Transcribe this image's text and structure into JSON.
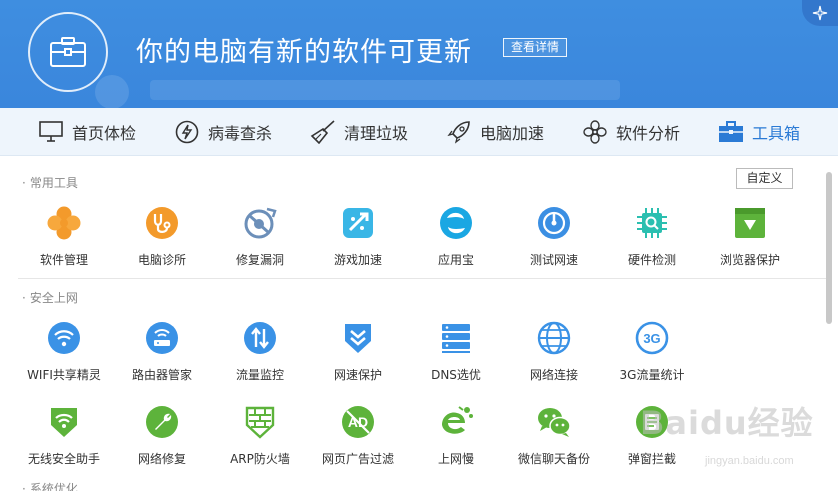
{
  "header": {
    "title": "你的电脑有新的软件可更新",
    "detail_button": "查看详情"
  },
  "nav": [
    {
      "label": "首页体检",
      "icon": "monitor-icon"
    },
    {
      "label": "病毒查杀",
      "icon": "lightning-icon"
    },
    {
      "label": "清理垃圾",
      "icon": "broom-icon"
    },
    {
      "label": "电脑加速",
      "icon": "rocket-icon"
    },
    {
      "label": "软件分析",
      "icon": "fan-icon"
    },
    {
      "label": "工具箱",
      "icon": "toolbox-icon",
      "active": true
    }
  ],
  "sections": {
    "common": "常用工具",
    "security": "安全上网",
    "optimize": "系统优化"
  },
  "custom_button": "自定义",
  "common_tools": [
    {
      "label": "软件管理",
      "icon": "clover-icon",
      "color": "#f39a2b"
    },
    {
      "label": "电脑诊所",
      "icon": "stethoscope-icon",
      "color": "#f39a2b"
    },
    {
      "label": "修复漏洞",
      "icon": "shield-repair-icon",
      "color": "#6c8fb9"
    },
    {
      "label": "游戏加速",
      "icon": "game-rocket-icon",
      "color": "#39b6e6"
    },
    {
      "label": "应用宝",
      "icon": "app-store-icon",
      "color": "#1aa7e3"
    },
    {
      "label": "测试网速",
      "icon": "speedometer-icon",
      "color": "#3b8fe3"
    },
    {
      "label": "硬件检测",
      "icon": "chip-icon",
      "color": "#2bbfb0"
    },
    {
      "label": "浏览器保护",
      "icon": "browser-shield-icon",
      "color": "#5db33b"
    }
  ],
  "security_tools": [
    {
      "label": "WIFI共享精灵",
      "icon": "wifi-share-icon",
      "color": "#3a92e6"
    },
    {
      "label": "路由器管家",
      "icon": "router-icon",
      "color": "#3a92e6"
    },
    {
      "label": "流量监控",
      "icon": "traffic-arrows-icon",
      "color": "#3a92e6"
    },
    {
      "label": "网速保护",
      "icon": "chevron-shield-icon",
      "color": "#3a92e6"
    },
    {
      "label": "DNS选优",
      "icon": "server-icon",
      "color": "#3a92e6"
    },
    {
      "label": "网络连接",
      "icon": "globe-icon",
      "color": "#3a92e6"
    },
    {
      "label": "3G流量统计",
      "icon": "3g-icon",
      "color": "#3a92e6",
      "text": "3G"
    }
  ],
  "network_tools": [
    {
      "label": "无线安全助手",
      "icon": "wifi-shield-icon",
      "color": "#5db33b"
    },
    {
      "label": "网络修复",
      "icon": "wrench-icon",
      "color": "#5db33b"
    },
    {
      "label": "ARP防火墙",
      "icon": "firewall-icon",
      "color": "#5db33b"
    },
    {
      "label": "网页广告过滤",
      "icon": "ad-block-icon",
      "color": "#5db33b",
      "text": "AD"
    },
    {
      "label": "上网慢",
      "icon": "ie-icon",
      "color": "#5db33b"
    },
    {
      "label": "微信聊天备份",
      "icon": "wechat-icon",
      "color": "#5db33b"
    },
    {
      "label": "弹窗拦截",
      "icon": "popup-block-icon",
      "color": "#5db33b"
    }
  ],
  "watermark": "Baidu经验",
  "watermark_sub": "jingyan.baidu.com"
}
